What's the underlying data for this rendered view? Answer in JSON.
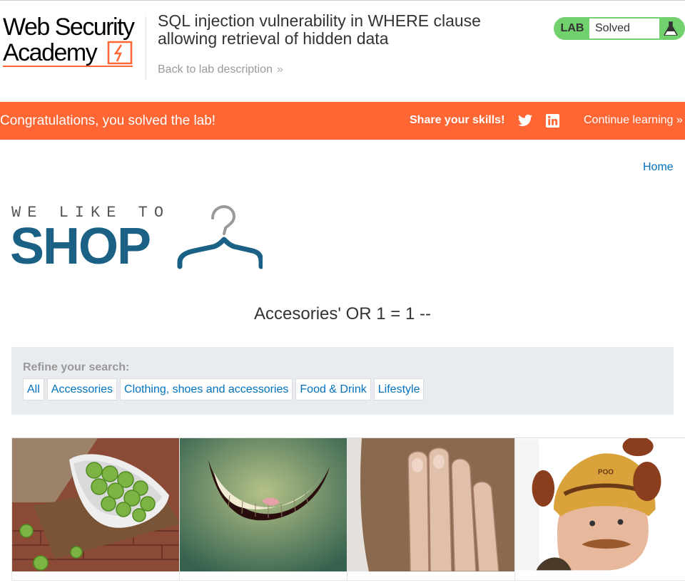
{
  "header": {
    "logo_line1": "Web Security",
    "logo_line2": "Academy",
    "lab_title": "SQL injection vulnerability in WHERE clause allowing retrieval of hidden data",
    "back_link": "Back to lab description",
    "lab_badge": "LAB",
    "status": "Solved"
  },
  "banner": {
    "message": "Congratulations, you solved the lab!",
    "share": "Share your skills!",
    "continue": "Continue learning"
  },
  "nav": {
    "home": "Home"
  },
  "shop_logo": {
    "tagline": "WE LIKE TO",
    "shop": "SHOP"
  },
  "search": {
    "title": "Accesories' OR 1 = 1 --"
  },
  "filter": {
    "label": "Refine your search:",
    "categories": [
      "All",
      "Accessories",
      "Clothing, shoes and accessories",
      "Food & Drink",
      "Lifestyle"
    ]
  },
  "products": [
    {
      "image": "brussels-sprouts-bowl"
    },
    {
      "image": "cheshire-cat-grin"
    },
    {
      "image": "hand-over-beard"
    },
    {
      "image": "poo-head-hat-man"
    }
  ],
  "colors": {
    "accent_orange": "#ff6633",
    "solved_green": "#70d16d",
    "link_blue": "#0071bc",
    "shop_blue": "#1a6185",
    "filter_bg": "#e8ecf0"
  }
}
